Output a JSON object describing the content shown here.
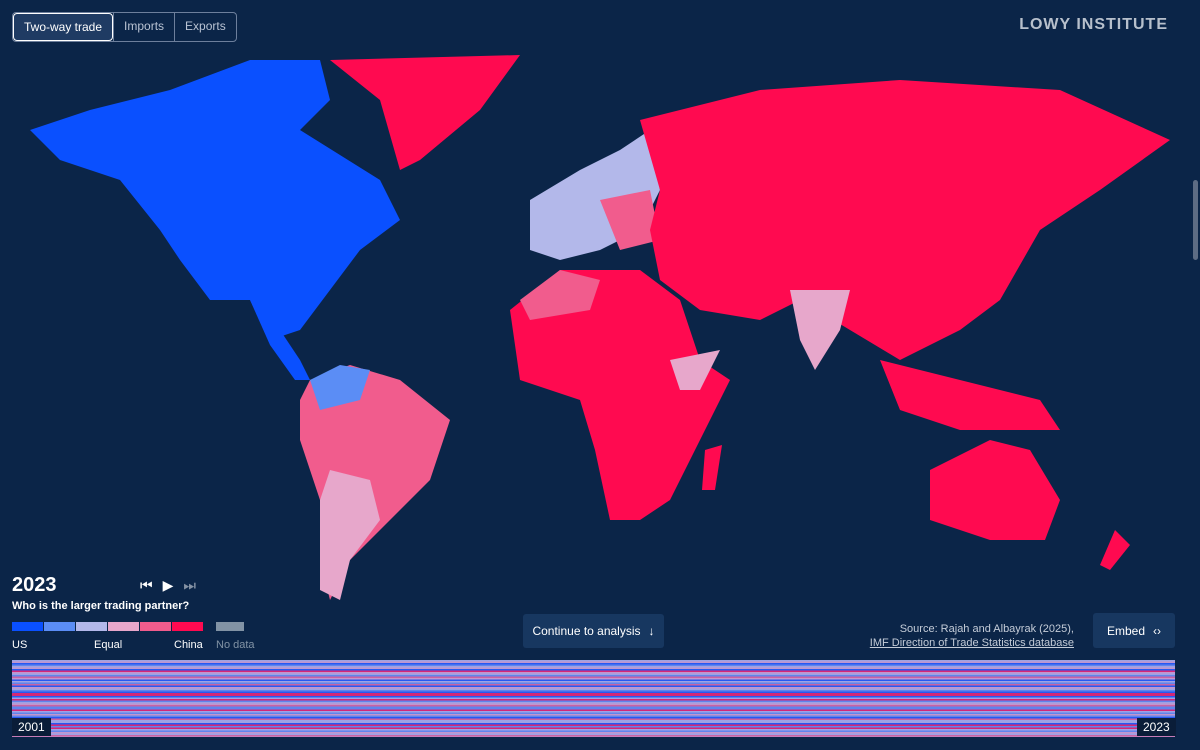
{
  "tabs": [
    {
      "label": "Two-way trade",
      "active": true
    },
    {
      "label": "Imports",
      "active": false
    },
    {
      "label": "Exports",
      "active": false
    }
  ],
  "brand": "LOWY INSTITUTE",
  "year": "2023",
  "question": "Who is the larger trading partner?",
  "legend": {
    "colors": [
      "#0a50ff",
      "#5b8df5",
      "#b3b8ea",
      "#e7a7cb",
      "#f15c8d",
      "#ff0a50"
    ],
    "nodata_color": "#8293a5",
    "labels": {
      "us": "US",
      "equal": "Equal",
      "china": "China",
      "nodata": "No data"
    }
  },
  "continue_label": "Continue to analysis",
  "source": {
    "text": "Source: Rajah and Albayrak (2025),",
    "link": "IMF Direction of Trade Statistics database"
  },
  "embed_label": "Embed",
  "timeline": {
    "start": "2001",
    "end": "2023"
  },
  "icons": {
    "first": "skip-back-icon",
    "play": "play-icon",
    "last": "skip-forward-icon",
    "arrow": "arrow-down-icon",
    "code": "code-icon"
  }
}
